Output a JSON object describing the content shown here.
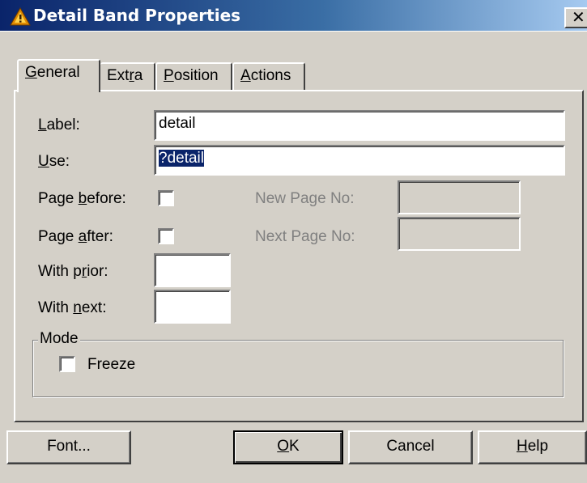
{
  "window": {
    "title": "Detail Band Properties",
    "close_glyph": "✕",
    "icon": "warning-triangle-icon"
  },
  "tabs": [
    {
      "label": "General",
      "accel": "G",
      "rest": "eneral",
      "active": true
    },
    {
      "label": "Extra",
      "pre": "Ext",
      "accel": "r",
      "rest": "a",
      "active": false
    },
    {
      "label": "Position",
      "accel": "P",
      "rest": "osition",
      "active": false
    },
    {
      "label": "Actions",
      "accel": "A",
      "rest": "ctions",
      "active": false
    }
  ],
  "general": {
    "label_field": {
      "label": "Label:",
      "accel": "L",
      "rest": "abel:",
      "value": "detail"
    },
    "use_field": {
      "label": "Use:",
      "accel": "U",
      "rest": "se:",
      "value": "?detail"
    },
    "page_before": {
      "label": "Page before:",
      "pre": "Page ",
      "accel": "b",
      "rest": "efore:",
      "checked": false
    },
    "page_after": {
      "label": "Page after:",
      "pre": "Page ",
      "accel": "a",
      "rest": "fter:",
      "checked": false
    },
    "new_page_no": {
      "label": "New Page No:",
      "value": ""
    },
    "next_page_no": {
      "label": "Next Page No:",
      "value": ""
    },
    "with_prior": {
      "label": "With prior:",
      "pre": "With p",
      "accel": "r",
      "rest": "ior:",
      "value": ""
    },
    "with_next": {
      "label": "With next:",
      "pre": "With ",
      "accel": "n",
      "rest": "ext:",
      "value": ""
    }
  },
  "mode": {
    "title": "Mode",
    "freeze": {
      "label": "Freeze",
      "checked": false
    }
  },
  "buttons": {
    "font": "Font...",
    "ok": {
      "accel": "O",
      "rest": "K"
    },
    "cancel": "Cancel",
    "help": {
      "accel": "H",
      "rest": "elp"
    }
  },
  "colors": {
    "face": "#d4d0c8",
    "title_start": "#0a246a",
    "title_end": "#a6caf0",
    "selection": "#0a246a"
  }
}
